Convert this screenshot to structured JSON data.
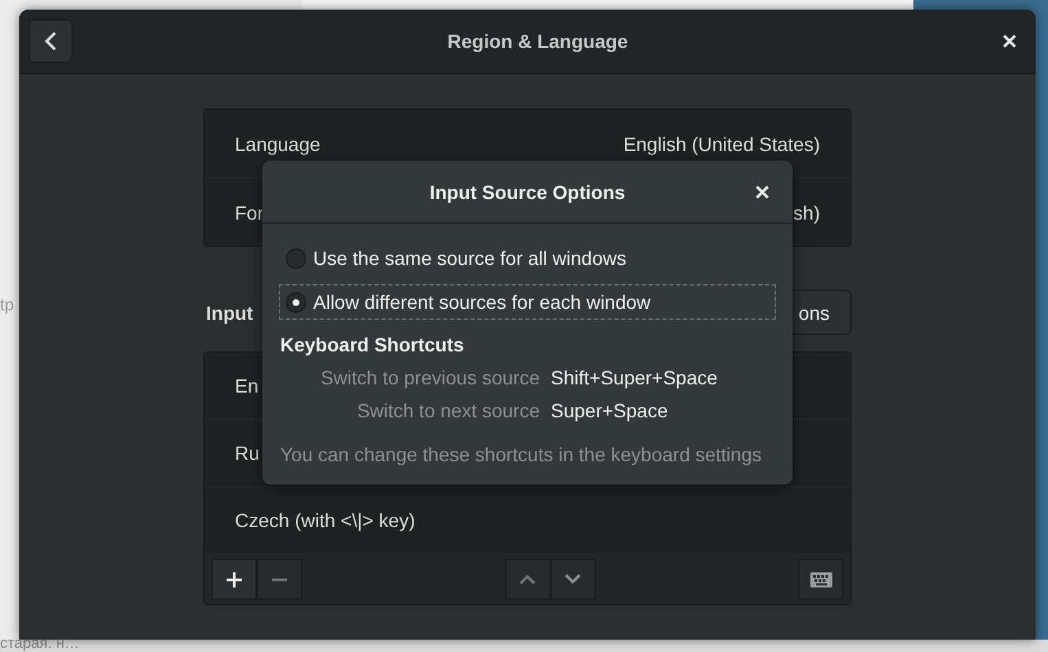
{
  "background": {
    "texts": [
      "tp",
      "старая. н…"
    ]
  },
  "window": {
    "title": "Region & Language"
  },
  "language_panel": {
    "rows": [
      {
        "label": "Language",
        "value": "English (United States)"
      },
      {
        "label": "For",
        "value": "sh)"
      }
    ]
  },
  "input_sources": {
    "heading": "Input",
    "options_button": "ons",
    "items": [
      "En",
      "Ru",
      "Czech (with <\\|> key)"
    ]
  },
  "dialog": {
    "title": "Input Source Options",
    "options": [
      {
        "label": "Use the same source for all windows",
        "selected": false
      },
      {
        "label": "Allow different sources for each window",
        "selected": true
      }
    ],
    "shortcuts_heading": "Keyboard Shortcuts",
    "shortcuts": [
      {
        "action": "Switch to previous source",
        "keys": "Shift+Super+Space"
      },
      {
        "action": "Switch to next source",
        "keys": "Super+Space"
      }
    ],
    "hint": "You can change these shortcuts in the keyboard settings"
  }
}
